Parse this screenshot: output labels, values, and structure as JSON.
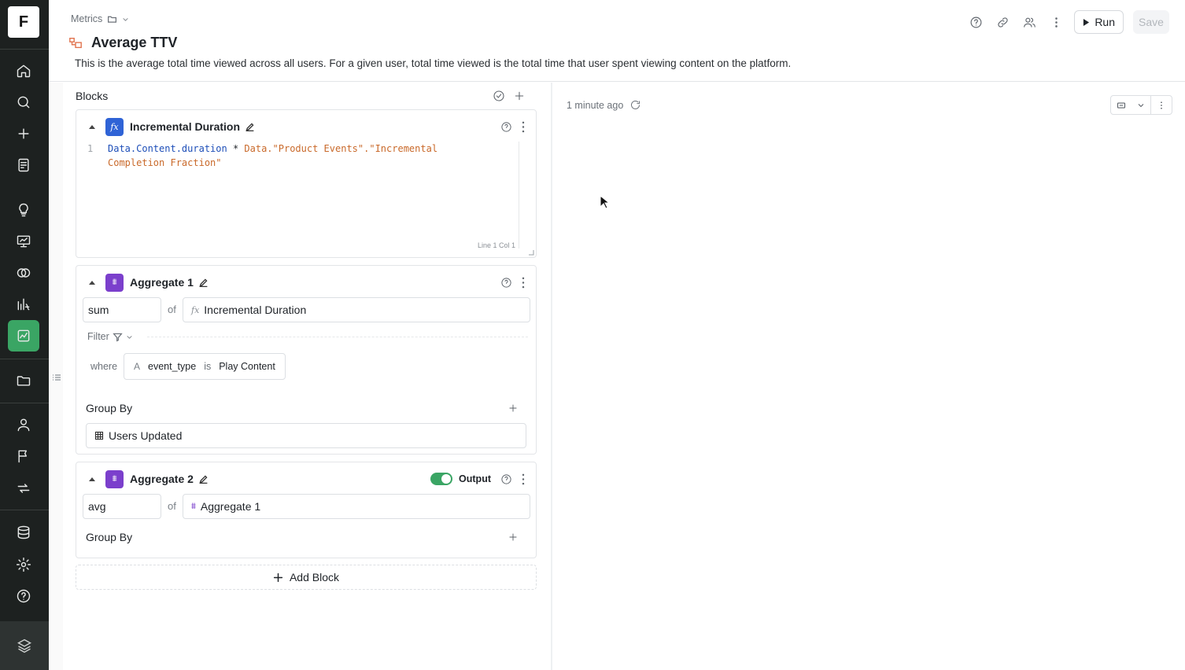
{
  "sidebar": {
    "logo_letter": "F",
    "items": [
      {
        "icon": "home-icon"
      },
      {
        "icon": "search-icon"
      },
      {
        "icon": "plus-icon"
      },
      {
        "icon": "notes-icon"
      },
      {
        "icon": "lightbulb-icon"
      },
      {
        "icon": "presentation-icon"
      },
      {
        "icon": "overlap-circles-icon"
      },
      {
        "icon": "formula-chart-icon"
      },
      {
        "icon": "metric-chart-icon",
        "active": true
      },
      {
        "icon": "folder-icon"
      },
      {
        "icon": "user-icon"
      },
      {
        "icon": "flag-icon"
      },
      {
        "icon": "sync-icon"
      },
      {
        "icon": "database-icon"
      },
      {
        "icon": "settings-icon"
      },
      {
        "icon": "help-icon"
      }
    ],
    "bottom_icon": "layers-logo-icon",
    "active_color": "#3aa564"
  },
  "header": {
    "breadcrumb": "Metrics",
    "title": "Average TTV",
    "description": "This is the average total time viewed across all users. For a given user, total time viewed is the total time that user spent viewing content on the platform.",
    "run_label": "Run",
    "save_label": "Save"
  },
  "blocks_panel": {
    "title": "Blocks",
    "formula_block": {
      "name": "Incremental Duration",
      "line_number": "1",
      "code_obj": "Data.Content.duration",
      "code_op": " * ",
      "code_str_obj": "Data.",
      "code_str": "\"Product Events\".\"Incremental Completion Fraction\"",
      "line_col": "Line 1 Col 1"
    },
    "aggregate1": {
      "name": "Aggregate 1",
      "function": "sum",
      "of_label": "of",
      "source": "Incremental Duration",
      "filter_label": "Filter",
      "where_label": "where",
      "condition_field": "event_type",
      "condition_op": "is",
      "condition_value": "Play Content",
      "group_by_label": "Group By",
      "group_by_value": "Users Updated"
    },
    "aggregate2": {
      "name": "Aggregate 2",
      "output_label": "Output",
      "function": "avg",
      "of_label": "of",
      "source": "Aggregate 1",
      "group_by_label": "Group By"
    },
    "add_block_label": "Add Block"
  },
  "results": {
    "updated": "1 minute ago"
  }
}
